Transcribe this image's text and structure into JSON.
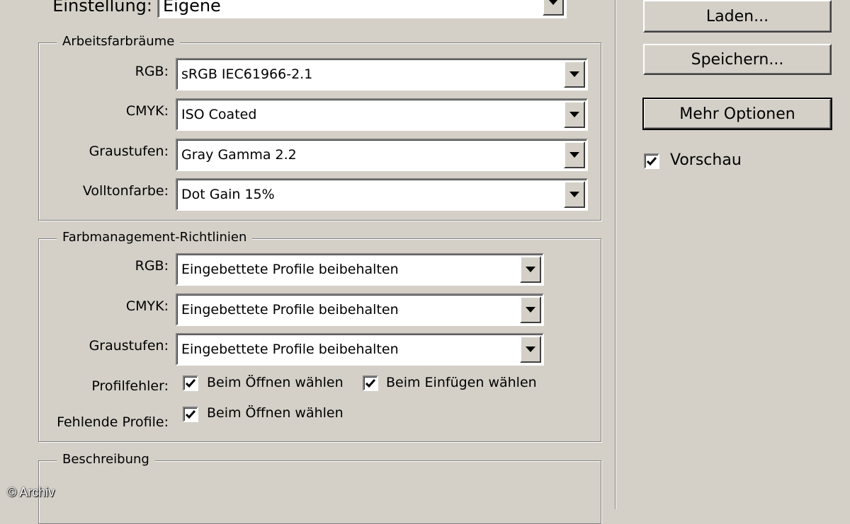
{
  "setting": {
    "label": "Einstellung:",
    "value": "Eigene"
  },
  "working_spaces": {
    "title": "Arbeitsfarbräume",
    "rows": [
      {
        "label": "RGB:",
        "value": "sRGB IEC61966-2.1"
      },
      {
        "label": "CMYK:",
        "value": "ISO Coated"
      },
      {
        "label": "Graustufen:",
        "value": "Gray Gamma 2.2"
      },
      {
        "label": "Volltonfarbe:",
        "value": "Dot Gain 15%"
      }
    ]
  },
  "policies": {
    "title": "Farbmanagement-Richtlinien",
    "rows": [
      {
        "label": "RGB:",
        "value": "Eingebettete Profile beibehalten"
      },
      {
        "label": "CMYK:",
        "value": "Eingebettete Profile beibehalten"
      },
      {
        "label": "Graustufen:",
        "value": "Eingebettete Profile beibehalten"
      }
    ],
    "profile_mismatch": {
      "label": "Profilfehler:",
      "ask_open": {
        "label": "Beim Öffnen wählen",
        "checked": true
      },
      "ask_paste": {
        "label": "Beim Einfügen wählen",
        "checked": true
      }
    },
    "missing_profiles": {
      "label": "Fehlende Profile:",
      "ask_open": {
        "label": "Beim Öffnen wählen",
        "checked": true
      }
    }
  },
  "description": {
    "title": "Beschreibung"
  },
  "buttons": {
    "load": "Laden...",
    "save": "Speichern...",
    "more_options": "Mehr Optionen"
  },
  "preview": {
    "label": "Vorschau",
    "checked": true
  },
  "copyright": "© Archiv",
  "icons": {
    "dropdown": "chevron-down-icon",
    "check": "checkmark-icon"
  }
}
